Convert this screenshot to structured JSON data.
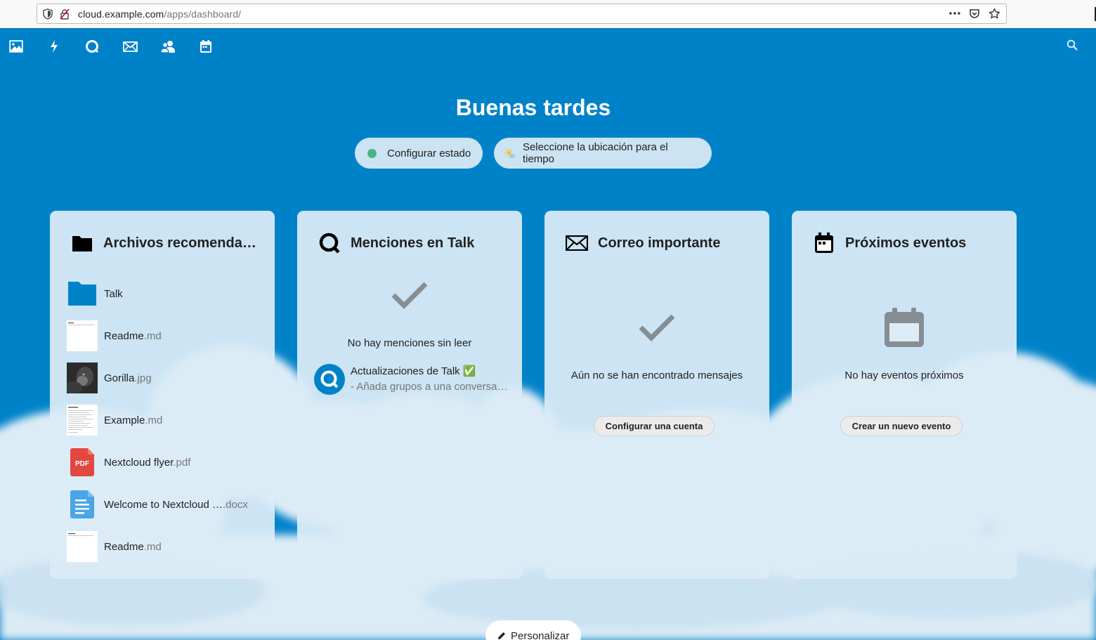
{
  "browser": {
    "url_host": "cloud.example.com",
    "url_path": "/apps/dashboard/"
  },
  "header": {
    "apps": [
      {
        "name": "photos-icon"
      },
      {
        "name": "activity-icon"
      },
      {
        "name": "talk-icon"
      },
      {
        "name": "mail-icon"
      },
      {
        "name": "contacts-icon"
      },
      {
        "name": "calendar-icon"
      }
    ],
    "search_icon": "search-icon"
  },
  "greeting": "Buenas tardes",
  "status": {
    "set_status_label": "Configurar estado",
    "weather_label": "Seleccione la ubicación para el tiempo",
    "status_color": "#49b382"
  },
  "panels": {
    "files": {
      "title": "Archivos recomendados",
      "items": [
        {
          "name": "Talk",
          "ext": "",
          "type": "folder"
        },
        {
          "name": "Readme",
          "ext": ".md",
          "type": "doc-preview"
        },
        {
          "name": "Gorilla",
          "ext": ".jpg",
          "type": "image"
        },
        {
          "name": "Example",
          "ext": ".md",
          "type": "doc-preview"
        },
        {
          "name": "Nextcloud flyer",
          "ext": ".pdf",
          "type": "pdf"
        },
        {
          "name": "Welcome to Nextcloud …",
          "ext": ".docx",
          "type": "document"
        },
        {
          "name": "Readme",
          "ext": ".md",
          "type": "doc-preview"
        }
      ]
    },
    "talk": {
      "title": "Menciones en Talk",
      "empty_text": "No hay menciones sin leer",
      "item_title": "Actualizaciones de Talk ✅",
      "item_sub": "- Añada grupos a una conversación"
    },
    "mail": {
      "title": "Correo importante",
      "empty_text": "Aún no se han encontrado mensajes",
      "button": "Configurar una cuenta"
    },
    "events": {
      "title": "Próximos eventos",
      "empty_text": "No hay eventos próximos",
      "button": "Crear un nuevo evento"
    }
  },
  "customize_label": "Personalizar",
  "colors": {
    "brand": "#0082c9",
    "pdf": "#e2483f",
    "doc": "#49a5e6"
  }
}
